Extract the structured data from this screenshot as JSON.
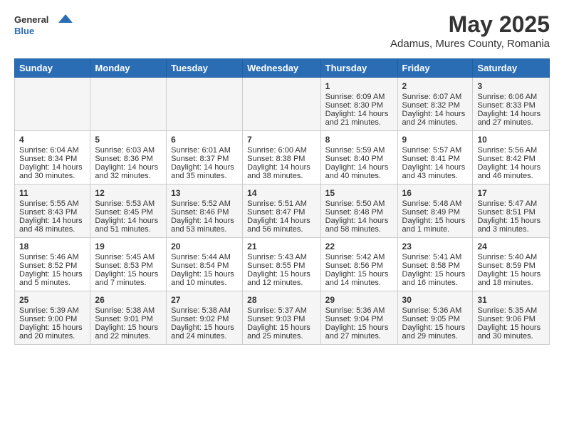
{
  "header": {
    "logo_general": "General",
    "logo_blue": "Blue",
    "month_title": "May 2025",
    "subtitle": "Adamus, Mures County, Romania"
  },
  "days_of_week": [
    "Sunday",
    "Monday",
    "Tuesday",
    "Wednesday",
    "Thursday",
    "Friday",
    "Saturday"
  ],
  "weeks": [
    [
      {
        "day": "",
        "info": ""
      },
      {
        "day": "",
        "info": ""
      },
      {
        "day": "",
        "info": ""
      },
      {
        "day": "",
        "info": ""
      },
      {
        "day": "1",
        "info": "Sunrise: 6:09 AM\nSunset: 8:30 PM\nDaylight: 14 hours\nand 21 minutes."
      },
      {
        "day": "2",
        "info": "Sunrise: 6:07 AM\nSunset: 8:32 PM\nDaylight: 14 hours\nand 24 minutes."
      },
      {
        "day": "3",
        "info": "Sunrise: 6:06 AM\nSunset: 8:33 PM\nDaylight: 14 hours\nand 27 minutes."
      }
    ],
    [
      {
        "day": "4",
        "info": "Sunrise: 6:04 AM\nSunset: 8:34 PM\nDaylight: 14 hours\nand 30 minutes."
      },
      {
        "day": "5",
        "info": "Sunrise: 6:03 AM\nSunset: 8:36 PM\nDaylight: 14 hours\nand 32 minutes."
      },
      {
        "day": "6",
        "info": "Sunrise: 6:01 AM\nSunset: 8:37 PM\nDaylight: 14 hours\nand 35 minutes."
      },
      {
        "day": "7",
        "info": "Sunrise: 6:00 AM\nSunset: 8:38 PM\nDaylight: 14 hours\nand 38 minutes."
      },
      {
        "day": "8",
        "info": "Sunrise: 5:59 AM\nSunset: 8:40 PM\nDaylight: 14 hours\nand 40 minutes."
      },
      {
        "day": "9",
        "info": "Sunrise: 5:57 AM\nSunset: 8:41 PM\nDaylight: 14 hours\nand 43 minutes."
      },
      {
        "day": "10",
        "info": "Sunrise: 5:56 AM\nSunset: 8:42 PM\nDaylight: 14 hours\nand 46 minutes."
      }
    ],
    [
      {
        "day": "11",
        "info": "Sunrise: 5:55 AM\nSunset: 8:43 PM\nDaylight: 14 hours\nand 48 minutes."
      },
      {
        "day": "12",
        "info": "Sunrise: 5:53 AM\nSunset: 8:45 PM\nDaylight: 14 hours\nand 51 minutes."
      },
      {
        "day": "13",
        "info": "Sunrise: 5:52 AM\nSunset: 8:46 PM\nDaylight: 14 hours\nand 53 minutes."
      },
      {
        "day": "14",
        "info": "Sunrise: 5:51 AM\nSunset: 8:47 PM\nDaylight: 14 hours\nand 56 minutes."
      },
      {
        "day": "15",
        "info": "Sunrise: 5:50 AM\nSunset: 8:48 PM\nDaylight: 14 hours\nand 58 minutes."
      },
      {
        "day": "16",
        "info": "Sunrise: 5:48 AM\nSunset: 8:49 PM\nDaylight: 15 hours\nand 1 minute."
      },
      {
        "day": "17",
        "info": "Sunrise: 5:47 AM\nSunset: 8:51 PM\nDaylight: 15 hours\nand 3 minutes."
      }
    ],
    [
      {
        "day": "18",
        "info": "Sunrise: 5:46 AM\nSunset: 8:52 PM\nDaylight: 15 hours\nand 5 minutes."
      },
      {
        "day": "19",
        "info": "Sunrise: 5:45 AM\nSunset: 8:53 PM\nDaylight: 15 hours\nand 7 minutes."
      },
      {
        "day": "20",
        "info": "Sunrise: 5:44 AM\nSunset: 8:54 PM\nDaylight: 15 hours\nand 10 minutes."
      },
      {
        "day": "21",
        "info": "Sunrise: 5:43 AM\nSunset: 8:55 PM\nDaylight: 15 hours\nand 12 minutes."
      },
      {
        "day": "22",
        "info": "Sunrise: 5:42 AM\nSunset: 8:56 PM\nDaylight: 15 hours\nand 14 minutes."
      },
      {
        "day": "23",
        "info": "Sunrise: 5:41 AM\nSunset: 8:58 PM\nDaylight: 15 hours\nand 16 minutes."
      },
      {
        "day": "24",
        "info": "Sunrise: 5:40 AM\nSunset: 8:59 PM\nDaylight: 15 hours\nand 18 minutes."
      }
    ],
    [
      {
        "day": "25",
        "info": "Sunrise: 5:39 AM\nSunset: 9:00 PM\nDaylight: 15 hours\nand 20 minutes."
      },
      {
        "day": "26",
        "info": "Sunrise: 5:38 AM\nSunset: 9:01 PM\nDaylight: 15 hours\nand 22 minutes."
      },
      {
        "day": "27",
        "info": "Sunrise: 5:38 AM\nSunset: 9:02 PM\nDaylight: 15 hours\nand 24 minutes."
      },
      {
        "day": "28",
        "info": "Sunrise: 5:37 AM\nSunset: 9:03 PM\nDaylight: 15 hours\nand 25 minutes."
      },
      {
        "day": "29",
        "info": "Sunrise: 5:36 AM\nSunset: 9:04 PM\nDaylight: 15 hours\nand 27 minutes."
      },
      {
        "day": "30",
        "info": "Sunrise: 5:36 AM\nSunset: 9:05 PM\nDaylight: 15 hours\nand 29 minutes."
      },
      {
        "day": "31",
        "info": "Sunrise: 5:35 AM\nSunset: 9:06 PM\nDaylight: 15 hours\nand 30 minutes."
      }
    ]
  ]
}
